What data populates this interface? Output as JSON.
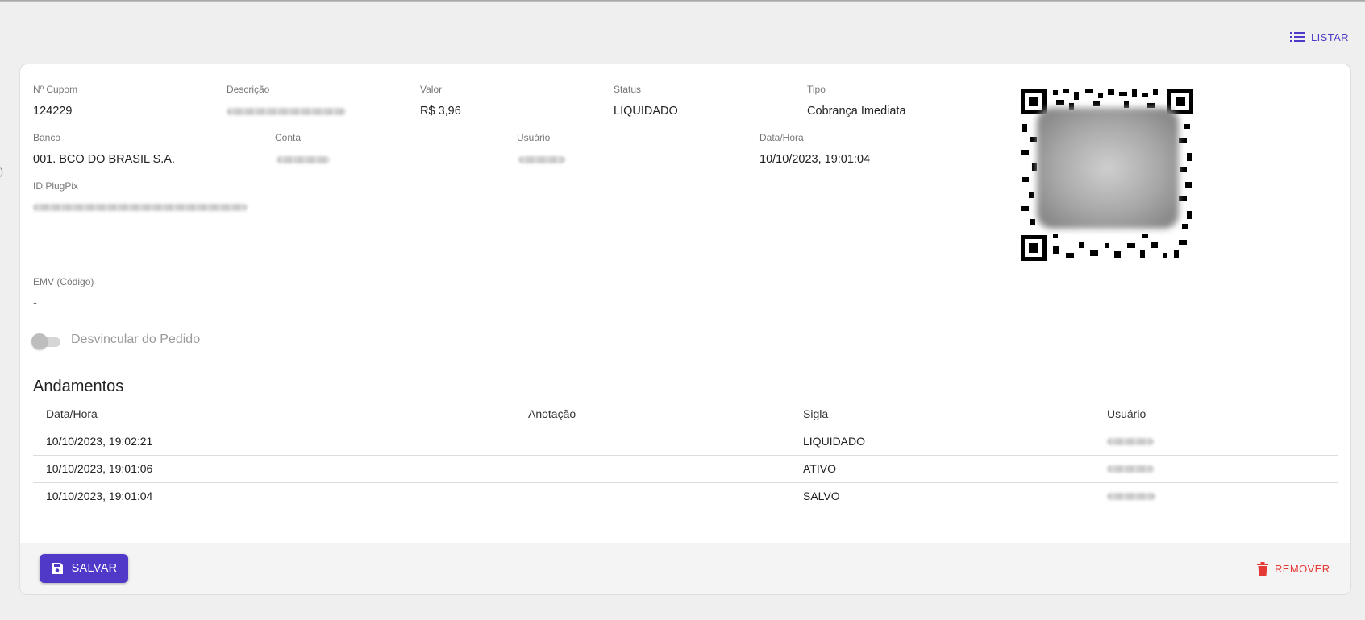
{
  "header": {
    "listar_label": "LISTAR"
  },
  "fields": {
    "cupom": {
      "label": "Nº Cupom",
      "value": "124229"
    },
    "descricao": {
      "label": "Descrição"
    },
    "valor": {
      "label": "Valor",
      "value": "R$ 3,96"
    },
    "status": {
      "label": "Status",
      "value": "LIQUIDADO"
    },
    "tipo": {
      "label": "Tipo",
      "value": "Cobrança Imediata"
    },
    "banco": {
      "label": "Banco",
      "value": "001. BCO DO BRASIL S.A."
    },
    "conta": {
      "label": "Conta"
    },
    "usuario": {
      "label": "Usuário"
    },
    "datahora": {
      "label": "Data/Hora",
      "value": "10/10/2023, 19:01:04"
    },
    "plugpix": {
      "label": "ID PlugPix"
    },
    "emv": {
      "label": "EMV (Código)",
      "value": "-"
    }
  },
  "toggle": {
    "label": "Desvincular do Pedido",
    "checked": false
  },
  "andamentos": {
    "title": "Andamentos",
    "columns": [
      "Data/Hora",
      "Anotação",
      "Sigla",
      "Usuário"
    ],
    "rows": [
      {
        "datahora": "10/10/2023, 19:02:21",
        "anotacao": "",
        "sigla": "LIQUIDADO"
      },
      {
        "datahora": "10/10/2023, 19:01:06",
        "anotacao": "",
        "sigla": "ATIVO"
      },
      {
        "datahora": "10/10/2023, 19:01:04",
        "anotacao": "",
        "sigla": "SALVO"
      }
    ]
  },
  "footer": {
    "save_label": "SALVAR",
    "remove_label": "REMOVER"
  },
  "colors": {
    "primary": "#5038c9",
    "danger": "#e53935",
    "background": "#efefef"
  },
  "icons": {
    "listar": "list-icon",
    "save": "floppy-disk-icon",
    "remove": "trash-icon"
  }
}
